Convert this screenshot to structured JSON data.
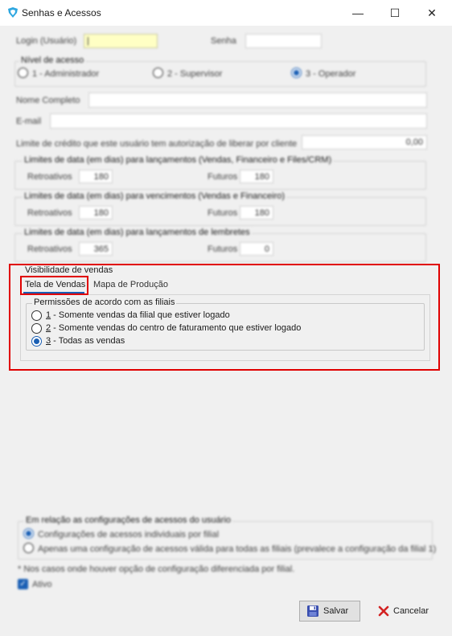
{
  "window": {
    "title": "Senhas e Acessos",
    "min_glyph": "—",
    "max_glyph": "☐",
    "close_glyph": "✕"
  },
  "login": {
    "login_label": "Login (Usuário)",
    "login_value": "|",
    "senha_label": "Senha"
  },
  "nivel": {
    "caption": "Nível de acesso",
    "options": [
      {
        "label": "1 - Administrador",
        "selected": false
      },
      {
        "label": "2 - Supervisor",
        "selected": false
      },
      {
        "label": "3 - Operador",
        "selected": true
      }
    ]
  },
  "nome_label": "Nome Completo",
  "email_label": "E-mail",
  "credito": {
    "label": "Limite de crédito que este usuário tem autorização de liberar por cliente",
    "value": "0,00"
  },
  "limites": [
    {
      "caption": "Limites de data (em dias) para lançamentos (Vendas, Financeiro e Files/CRM)",
      "retro_label": "Retroativos",
      "retro_value": "180",
      "futuros_label": "Futuros",
      "futuros_value": "180"
    },
    {
      "caption": "Limites de data (em dias) para vencimentos (Vendas e Financeiro)",
      "retro_label": "Retroativos",
      "retro_value": "180",
      "futuros_label": "Futuros",
      "futuros_value": "180"
    },
    {
      "caption": "Limites de data (em dias) para lançamentos de lembretes",
      "retro_label": "Retroativos",
      "retro_value": "365",
      "futuros_label": "Futuros",
      "futuros_value": "0"
    }
  ],
  "visibilidade": {
    "caption": "Visibilidade de vendas",
    "tabs": [
      {
        "label": "Tela de Vendas",
        "active": true
      },
      {
        "label": "Mapa de Produção",
        "active": false
      }
    ],
    "permissoes_caption": "Permissões de acordo com as filiais",
    "options": [
      {
        "num": "1",
        "text": " - Somente vendas da filial que estiver logado",
        "selected": false
      },
      {
        "num": "2",
        "text": " - Somente vendas do centro de faturamento que estiver logado",
        "selected": false
      },
      {
        "num": "3",
        "text": " - Todas as vendas",
        "selected": true
      }
    ]
  },
  "config": {
    "caption": "Em relação as configurações de acessos do usuário",
    "options": [
      {
        "label": "Configurações de acessos individuais por filial",
        "selected": true
      },
      {
        "label": "Apenas uma configuração de acessos válida para todas as filiais (prevalece a configuração da filial 1)",
        "selected": false
      }
    ],
    "note": "* Nos casos onde houver opção de configuração diferenciada por filial.",
    "ativo_label": "Ativo"
  },
  "actions": {
    "salvar": "Salvar",
    "cancelar": "Cancelar"
  },
  "colors": {
    "accent": "#1a5fb4",
    "highlight_red": "#e00000",
    "cancel_red": "#d32222",
    "salvar_icon": "#3a4fb0"
  }
}
